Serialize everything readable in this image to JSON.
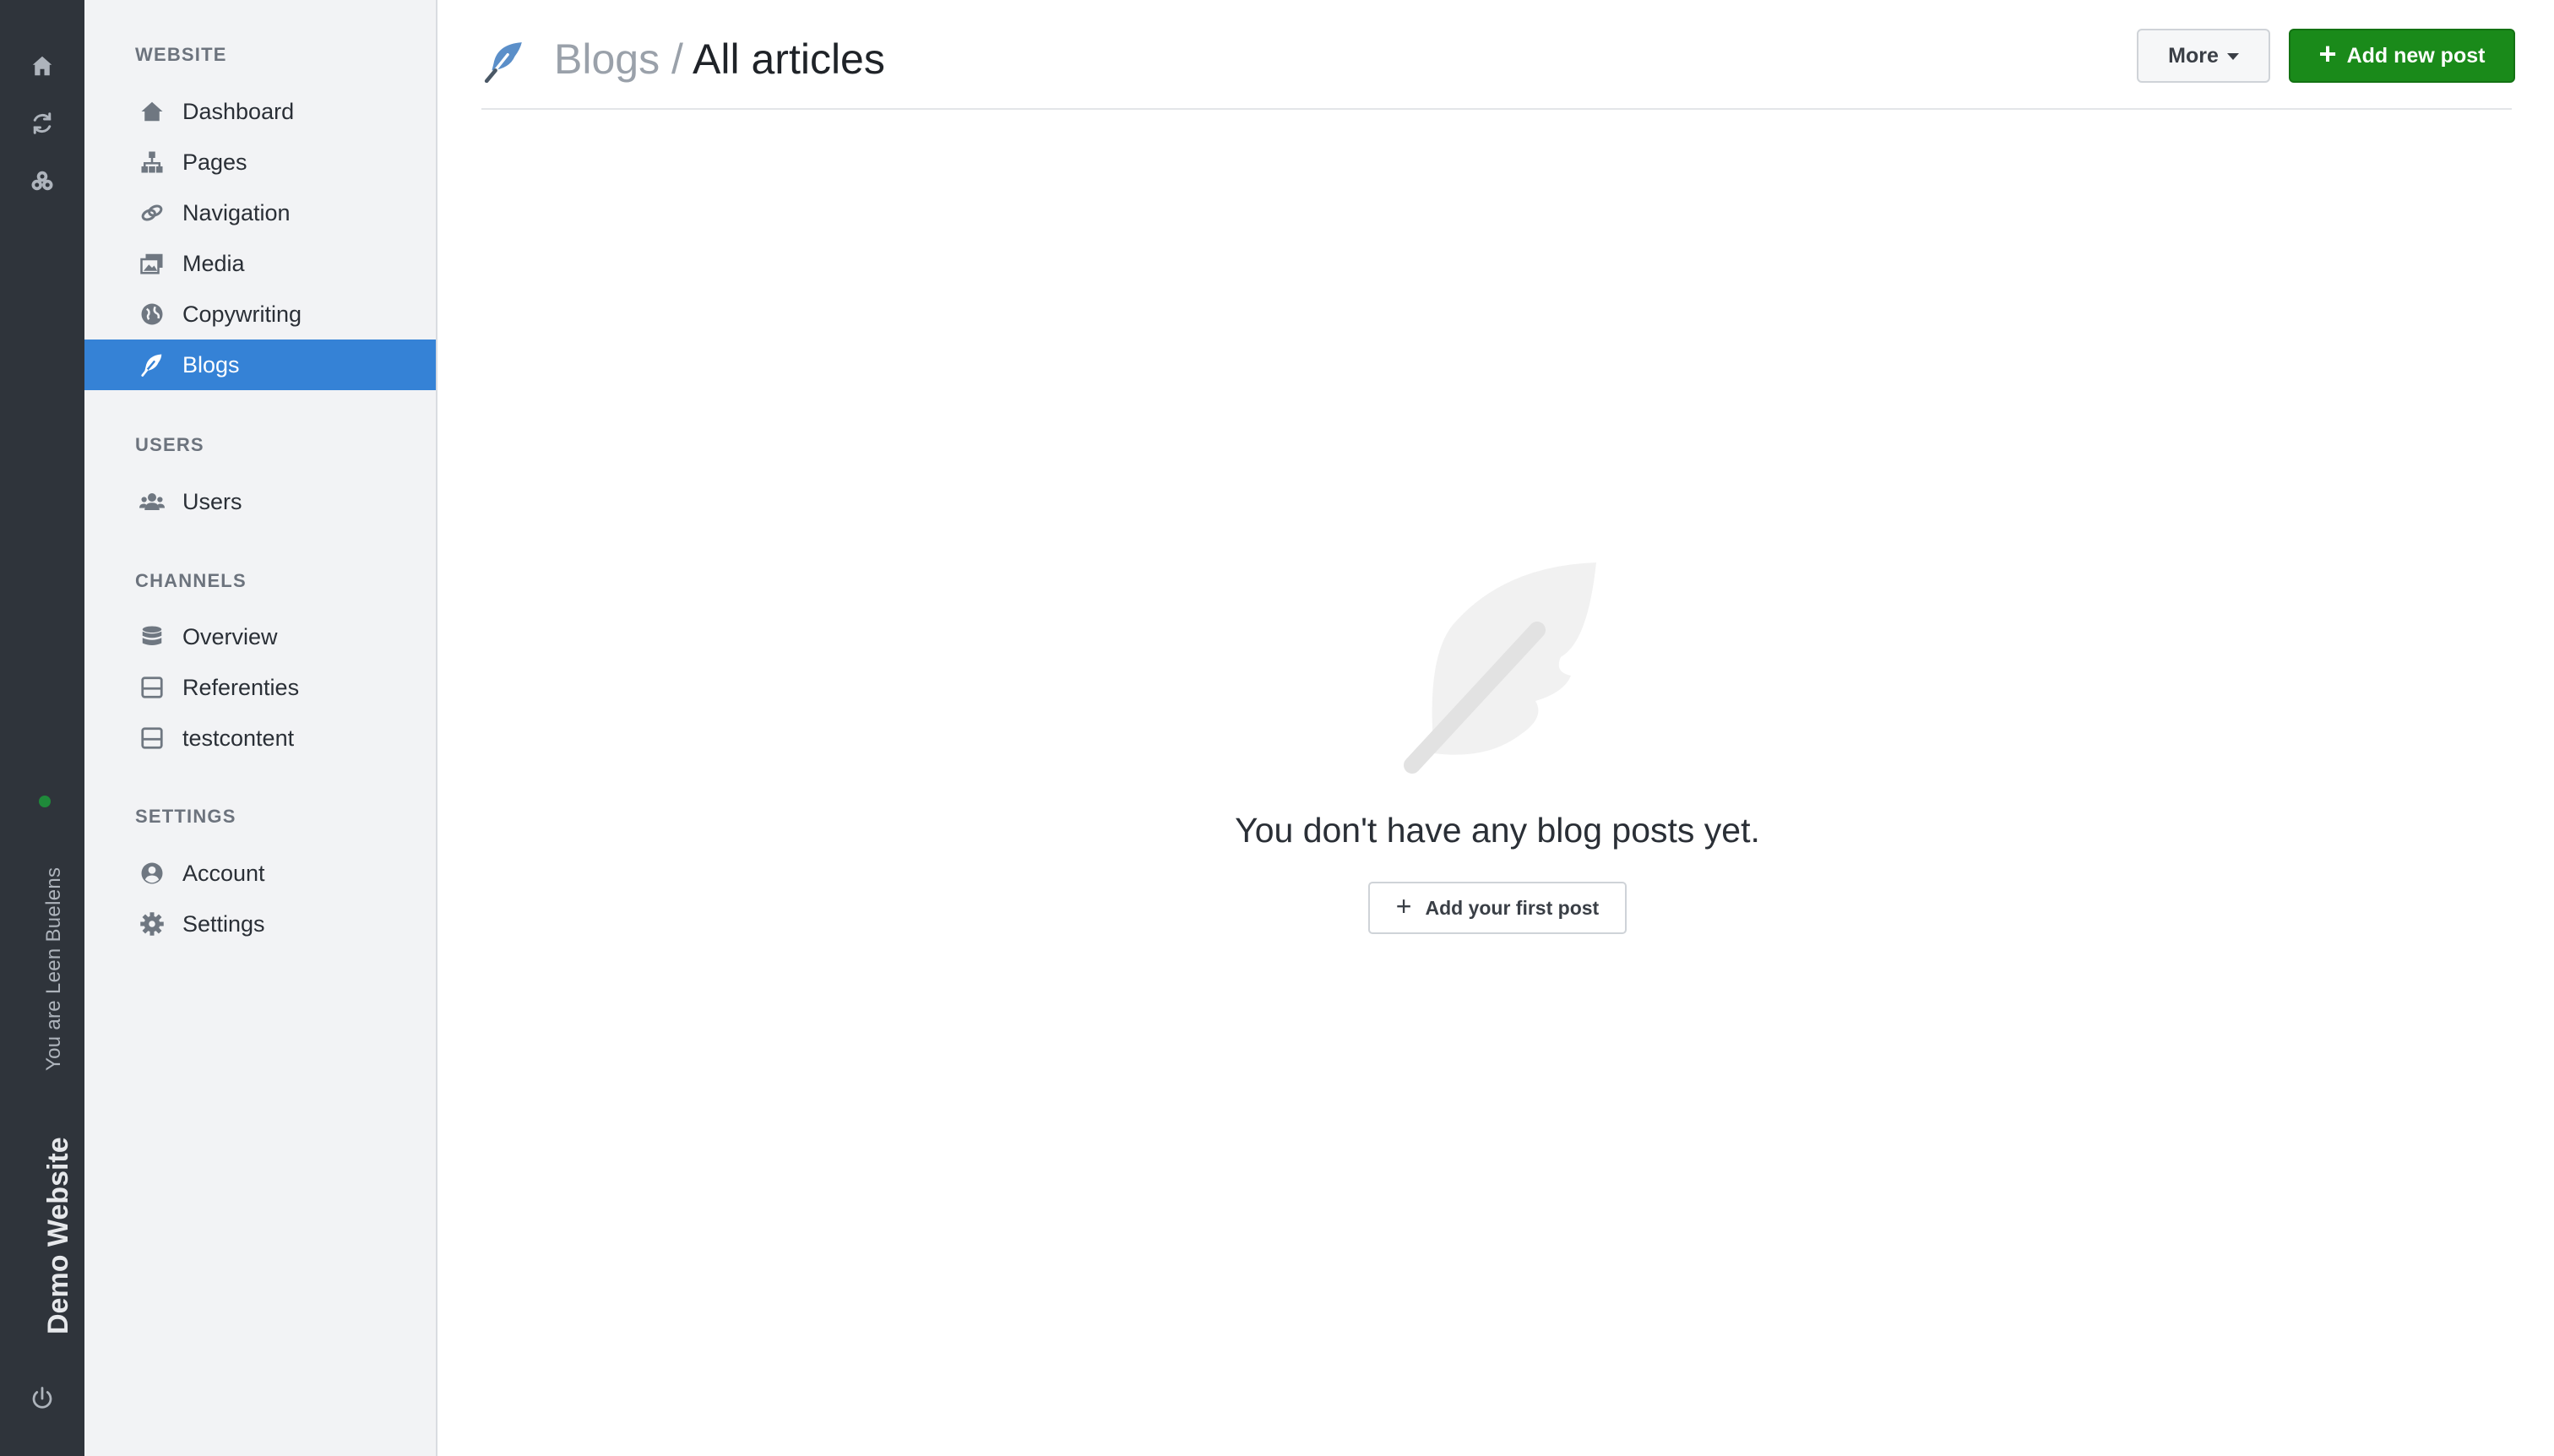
{
  "rail": {
    "user_text": "You are Leen Buelens",
    "site_name": "Demo Website",
    "status_color": "#1f8a3a"
  },
  "sidebar": {
    "sections": [
      {
        "title": "WEBSITE"
      },
      {
        "title": "USERS"
      },
      {
        "title": "CHANNELS"
      },
      {
        "title": "SETTINGS"
      }
    ],
    "items": [
      {
        "label": "Dashboard",
        "icon": "home-icon"
      },
      {
        "label": "Pages",
        "icon": "sitemap-icon"
      },
      {
        "label": "Navigation",
        "icon": "link-icon"
      },
      {
        "label": "Media",
        "icon": "images-icon"
      },
      {
        "label": "Copywriting",
        "icon": "globe-icon"
      },
      {
        "label": "Blogs",
        "icon": "feather-icon",
        "active": true
      },
      {
        "label": "Users",
        "icon": "users-icon"
      },
      {
        "label": "Overview",
        "icon": "database-icon"
      },
      {
        "label": "Referenties",
        "icon": "channel-icon"
      },
      {
        "label": "testcontent",
        "icon": "channel-icon"
      },
      {
        "label": "Account",
        "icon": "user-circle-icon"
      },
      {
        "label": "Settings",
        "icon": "gear-icon"
      }
    ],
    "active_color": "#3582d6"
  },
  "header": {
    "crumb_parent": "Blogs",
    "crumb_sep": "/",
    "crumb_current": "All articles",
    "more_label": "More",
    "add_label": "Add new post",
    "add_color": "#1a8a1a"
  },
  "empty": {
    "message": "You don't have any blog posts yet.",
    "button_label": "Add your first post"
  }
}
